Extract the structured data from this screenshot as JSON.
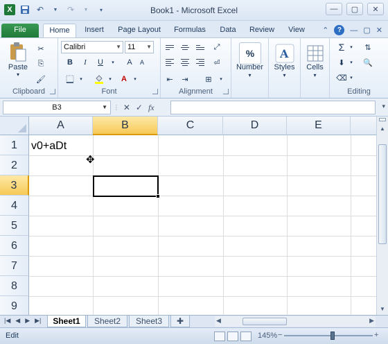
{
  "window": {
    "title": "Book1  -  Microsoft Excel"
  },
  "tabs": [
    {
      "label": "File"
    },
    {
      "label": "Home"
    },
    {
      "label": "Insert"
    },
    {
      "label": "Page Layout"
    },
    {
      "label": "Formulas"
    },
    {
      "label": "Data"
    },
    {
      "label": "Review"
    },
    {
      "label": "View"
    }
  ],
  "ribbon": {
    "clipboard": {
      "label": "Clipboard",
      "paste_label": "Paste"
    },
    "font": {
      "label": "Font",
      "font_name": "Calibri",
      "font_size": "11",
      "bold": "B",
      "italic": "I",
      "underline": "U"
    },
    "alignment": {
      "label": "Alignment"
    },
    "number": {
      "label": "Number",
      "icon_text": "%"
    },
    "styles": {
      "label": "Styles"
    },
    "cells": {
      "label": "Cells"
    },
    "editing": {
      "label": "Editing",
      "sum_icon": "Σ"
    }
  },
  "formula_bar": {
    "name_box": "B3",
    "fx": "fx",
    "formula": ""
  },
  "grid": {
    "columns": [
      "A",
      "B",
      "C",
      "D",
      "E"
    ],
    "rows": [
      "1",
      "2",
      "3",
      "4",
      "5",
      "6",
      "7",
      "8",
      "9"
    ],
    "selected_column": "B",
    "selected_row": "3",
    "cells": {
      "A1": "v0+aDt"
    }
  },
  "sheets": [
    {
      "label": "Sheet1"
    },
    {
      "label": "Sheet2"
    },
    {
      "label": "Sheet3"
    }
  ],
  "status": {
    "mode": "Edit",
    "zoom": "145%"
  }
}
